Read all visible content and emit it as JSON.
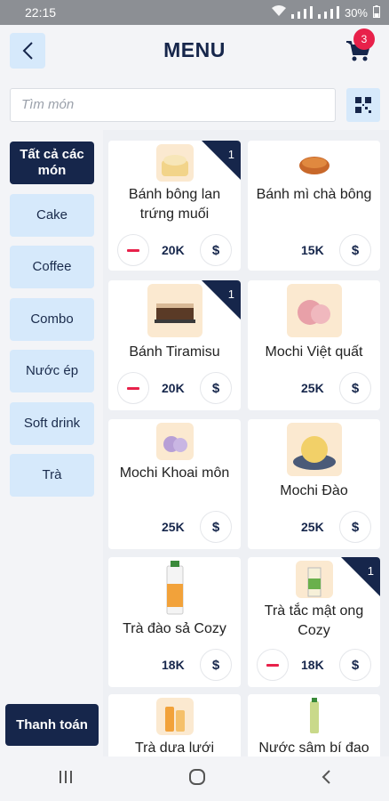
{
  "status": {
    "time": "22:15",
    "battery": "30%"
  },
  "header": {
    "title": "MENU",
    "cart_count": "3"
  },
  "search": {
    "placeholder": "Tìm món"
  },
  "sidebar": {
    "categories": [
      {
        "label": "Tất cả các món",
        "active": true
      },
      {
        "label": "Cake"
      },
      {
        "label": "Coffee"
      },
      {
        "label": "Combo"
      },
      {
        "label": "Nước ép"
      },
      {
        "label": "Soft drink"
      },
      {
        "label": "Trà"
      }
    ],
    "checkout_label": "Thanh toán"
  },
  "products": [
    {
      "name": "Bánh bông lan trứng muối",
      "price": "20K",
      "qty": "1",
      "buy": "$"
    },
    {
      "name": "Bánh mì chà bông",
      "price": "15K",
      "buy": "$"
    },
    {
      "name": "Bánh Tiramisu",
      "price": "20K",
      "qty": "1",
      "buy": "$"
    },
    {
      "name": "Mochi Việt quất",
      "price": "25K",
      "buy": "$"
    },
    {
      "name": "Mochi Khoai môn",
      "price": "25K",
      "buy": "$"
    },
    {
      "name": "Mochi Đào",
      "price": "25K",
      "buy": "$"
    },
    {
      "name": "Trà đào sả Cozy",
      "price": "18K",
      "buy": "$"
    },
    {
      "name": "Trà tắc mật ong Cozy",
      "price": "18K",
      "qty": "1",
      "buy": "$"
    },
    {
      "name": "Trà dưa lưới"
    },
    {
      "name": "Nước sâm bí đao"
    }
  ],
  "colors": {
    "primary": "#16264b",
    "accent": "#e8214a",
    "light": "#d6e9fb"
  }
}
